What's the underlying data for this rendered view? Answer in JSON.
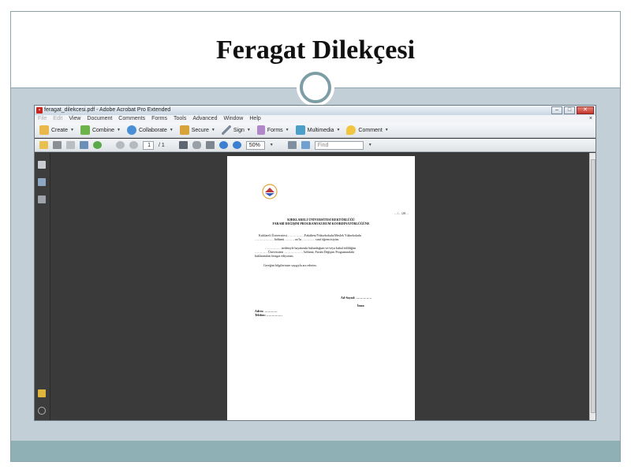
{
  "slide": {
    "title": "Feragat Dilekçesi",
    "colors": {
      "background": "#c3cfd6",
      "accent": "#7d9ea5",
      "footer": "#8fb0b5"
    }
  },
  "acrobat": {
    "window_title": "feragat_dilekcesi.pdf - Adobe Acrobat Pro Extended",
    "menu": [
      "File",
      "Edit",
      "View",
      "Document",
      "Comments",
      "Forms",
      "Tools",
      "Advanced",
      "Window",
      "Help"
    ],
    "toolbar1": [
      {
        "label": "Create",
        "icon": "create-icon",
        "color": "#e9b84a"
      },
      {
        "label": "Combine",
        "icon": "combine-icon",
        "color": "#6db34b"
      },
      {
        "label": "Collaborate",
        "icon": "collaborate-icon",
        "color": "#4a8fd6"
      },
      {
        "label": "Secure",
        "icon": "lock-icon",
        "color": "#d7a43a"
      },
      {
        "label": "Sign",
        "icon": "pen-icon",
        "color": "#7b8899"
      },
      {
        "label": "Forms",
        "icon": "forms-icon",
        "color": "#b088c8"
      },
      {
        "label": "Multimedia",
        "icon": "multimedia-icon",
        "color": "#4aa0c9"
      },
      {
        "label": "Comment",
        "icon": "comment-icon",
        "color": "#f0c540"
      }
    ],
    "page_current": "1",
    "page_total": "/ 1",
    "zoom": "50%",
    "find_placeholder": "Find"
  },
  "pdf_page": {
    "date": "…/…/20…",
    "heading_line1": "KIRKLARELİ ÜNİVERSİTESİ REKTÖRLÜĞÜ",
    "heading_line2": "FARABİ DEĞİŞİM PROGRAMI KURUM KOORDİNATÖRLÜĞÜNE",
    "para1_a": "Kırklareli Üniversitesi …………….Fakültesi/Yüksekokulu/Meslek Yüksekokulu",
    "para1_b": "……………… bölümü ……… no'lu ………… sınıf öğrencisiyim.",
    "para2_a": "…………… nedeniyle hayatımda bulunduğum ve/veya kabul edildiğim",
    "para2_b": "………… Üniversitesi ……………… bölümü, Farabi Değişim Programındaki",
    "para2_c": "haklarımdan feragat ediyorum.",
    "closing": "Gereğini bilgilerinize saygıyla arz ederim.",
    "name_label": "Ad-Soyad: ……………",
    "signature_label": "İmza",
    "address_label": "Adres: …………",
    "phone_label": "Telefon: ……………"
  }
}
